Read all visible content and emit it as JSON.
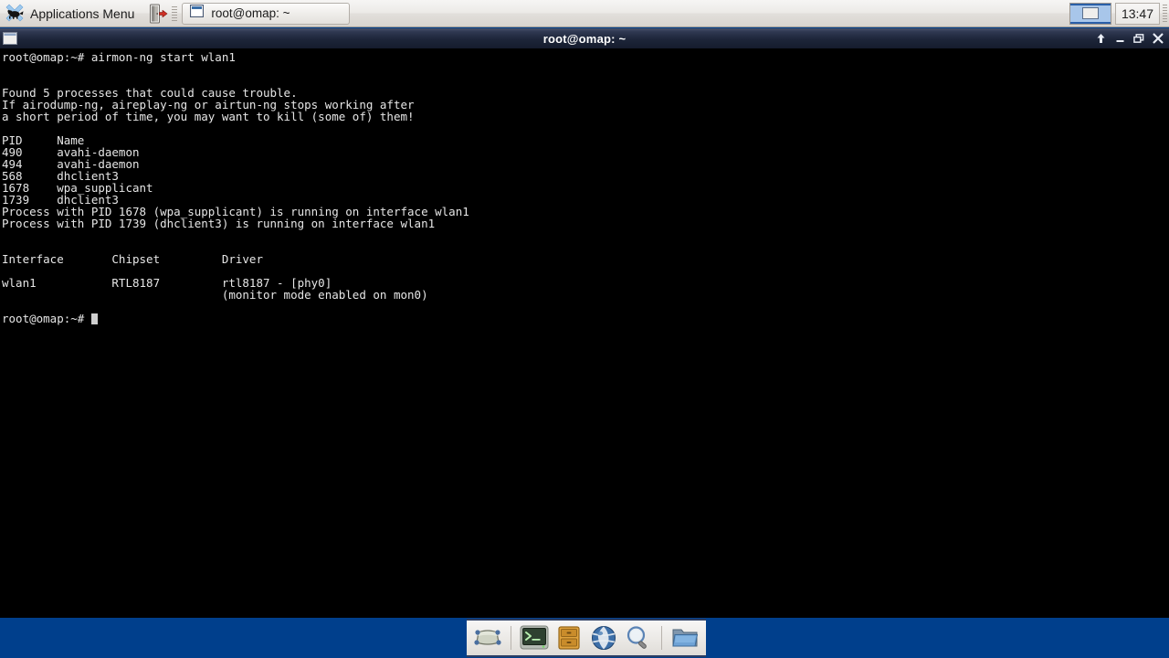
{
  "panel": {
    "apps_menu": {
      "label": "Applications Menu",
      "icon": "xfce-mouse-icon"
    },
    "logout_icon": "logout-door-icon",
    "tasklist": [
      {
        "label": "root@omap: ~",
        "icon": "window-icon"
      }
    ],
    "pager": {
      "icon": "workspace-switcher-icon",
      "active_workspace": "1"
    },
    "clock": {
      "time": "13:47"
    }
  },
  "window": {
    "title": "root@omap: ~",
    "menu_icon": "window-menu-icon",
    "buttons": [
      {
        "name": "shade-button",
        "glyph": "↑"
      },
      {
        "name": "minimize-button",
        "glyph": "–"
      },
      {
        "name": "maximize-button",
        "glyph": "❐"
      },
      {
        "name": "close-button",
        "glyph": "✕"
      }
    ]
  },
  "terminal": {
    "lines": [
      "root@omap:~# airmon-ng start wlan1",
      "",
      "",
      "Found 5 processes that could cause trouble.",
      "If airodump-ng, aireplay-ng or airtun-ng stops working after",
      "a short period of time, you may want to kill (some of) them!",
      "",
      "PID     Name",
      "490     avahi-daemon",
      "494     avahi-daemon",
      "568     dhclient3",
      "1678    wpa_supplicant",
      "1739    dhclient3",
      "Process with PID 1678 (wpa_supplicant) is running on interface wlan1",
      "Process with PID 1739 (dhclient3) is running on interface wlan1",
      "",
      "",
      "Interface       Chipset         Driver",
      "",
      "wlan1           RTL8187         rtl8187 - [phy0]",
      "                                (monitor mode enabled on mon0)",
      ""
    ],
    "prompt": "root@omap:~# ",
    "cursor": "block-cursor",
    "command": "airmon-ng start wlan1",
    "processes": {
      "count": "5",
      "headers": [
        "PID",
        "Name"
      ],
      "rows": [
        {
          "pid": "490",
          "name": "avahi-daemon"
        },
        {
          "pid": "494",
          "name": "avahi-daemon"
        },
        {
          "pid": "568",
          "name": "dhclient3"
        },
        {
          "pid": "1678",
          "name": "wpa_supplicant"
        },
        {
          "pid": "1739",
          "name": "dhclient3"
        }
      ]
    },
    "interfaces": {
      "headers": [
        "Interface",
        "Chipset",
        "Driver"
      ],
      "rows": [
        {
          "interface": "wlan1",
          "chipset": "RTL8187",
          "driver": "rtl8187 - [phy0]",
          "note": "(monitor mode enabled on mon0)"
        }
      ]
    }
  },
  "dock": {
    "items": [
      {
        "name": "show-desktop-icon",
        "label": "Show Desktop"
      },
      {
        "name": "terminal-icon",
        "label": "Terminal"
      },
      {
        "name": "file-cabinet-icon",
        "label": "Archive Manager"
      },
      {
        "name": "web-browser-icon",
        "label": "Web Browser"
      },
      {
        "name": "search-icon",
        "label": "Find Files"
      },
      {
        "name": "file-manager-icon",
        "label": "File Manager"
      }
    ]
  },
  "colors": {
    "desktop_blue": "#003f8c",
    "terminal_bg": "#000000",
    "terminal_fg": "#e6e6e6",
    "titlebar_dark": "#1d2539",
    "panel_light": "#eceae7"
  }
}
